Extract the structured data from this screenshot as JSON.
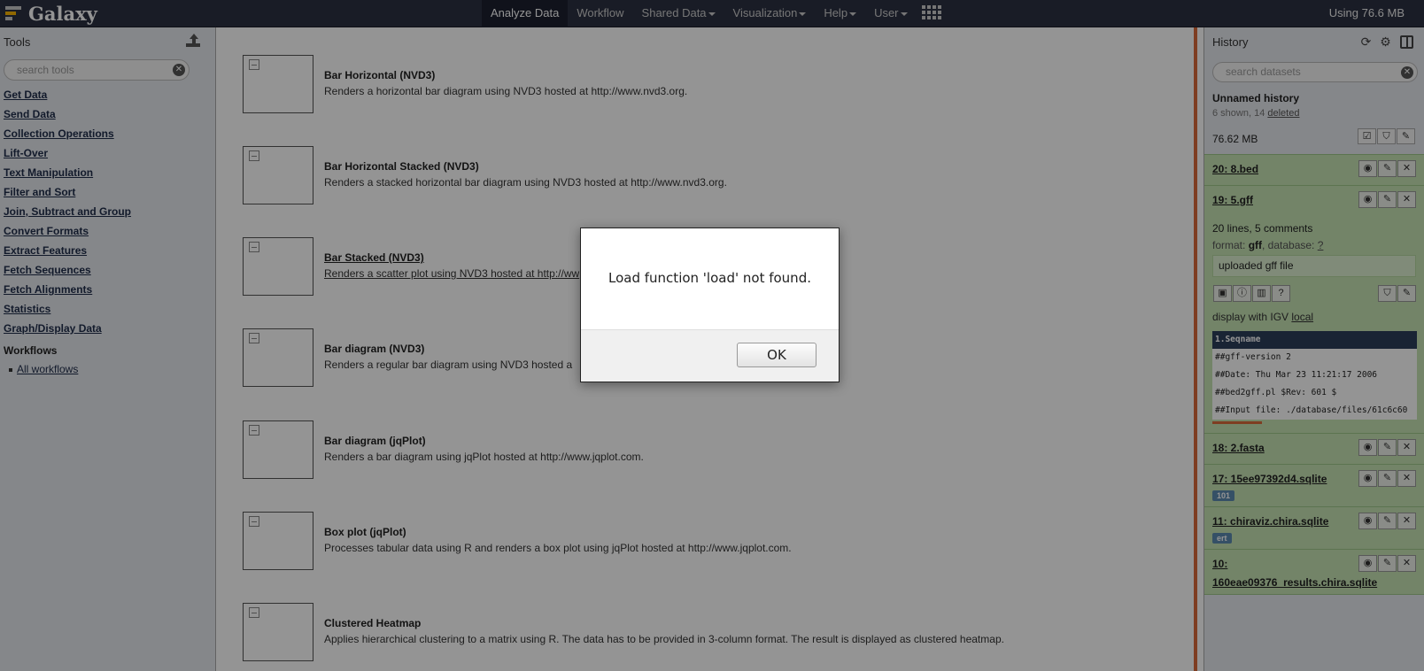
{
  "masthead": {
    "brand": "Galaxy",
    "nav": [
      {
        "label": "Analyze Data",
        "active": true,
        "dropdown": false
      },
      {
        "label": "Workflow",
        "active": false,
        "dropdown": false
      },
      {
        "label": "Shared Data",
        "active": false,
        "dropdown": true
      },
      {
        "label": "Visualization",
        "active": false,
        "dropdown": true
      },
      {
        "label": "Help",
        "active": false,
        "dropdown": true
      },
      {
        "label": "User",
        "active": false,
        "dropdown": true
      }
    ],
    "quota": "Using 76.6 MB"
  },
  "tools": {
    "title": "Tools",
    "search_placeholder": "search tools",
    "sections": [
      "Get Data",
      "Send Data",
      "Collection Operations",
      "Lift-Over",
      "Text Manipulation",
      "Filter and Sort",
      "Join, Subtract and Group",
      "Convert Formats",
      "Extract Features",
      "Fetch Sequences",
      "Fetch Alignments",
      "Statistics",
      "Graph/Display Data"
    ],
    "workflows_title": "Workflows",
    "workflows_link": "All workflows"
  },
  "visualizations": [
    {
      "name": "Bar Horizontal (NVD3)",
      "desc": "Renders a horizontal bar diagram using NVD3 hosted at http://www.nvd3.org."
    },
    {
      "name": "Bar Horizontal Stacked (NVD3)",
      "desc": "Renders a stacked horizontal bar diagram using NVD3 hosted at http://www.nvd3.org."
    },
    {
      "name": "Bar Stacked (NVD3)",
      "desc": "Renders a scatter plot using NVD3 hosted at http://ww"
    },
    {
      "name": "Bar diagram (NVD3)",
      "desc": "Renders a regular bar diagram using NVD3 hosted a"
    },
    {
      "name": "Bar diagram (jqPlot)",
      "desc": "Renders a bar diagram using jqPlot hosted at http://www.jqplot.com."
    },
    {
      "name": "Box plot (jqPlot)",
      "desc": "Processes tabular data using R and renders a box plot using jqPlot hosted at http://www.jqplot.com."
    },
    {
      "name": "Clustered Heatmap",
      "desc": "Applies hierarchical clustering to a matrix using R. The data has to be provided in 3-column format. The result is displayed as clustered heatmap."
    }
  ],
  "history": {
    "title": "History",
    "search_placeholder": "search datasets",
    "name": "Unnamed history",
    "counts_prefix": "6 shown, 14 ",
    "counts_link": "deleted",
    "size": "76.62 MB",
    "datasets": [
      {
        "title": "20: 8.bed"
      },
      {
        "title": "19: 5.gff"
      },
      {
        "title": "18: 2.fasta"
      },
      {
        "title": "17: 15ee97392d4.sqlite",
        "tag": "101"
      },
      {
        "title": "11: chiraviz.chira.sqlite",
        "tag": "ert"
      },
      {
        "title": "10:",
        "title2": "160eae09376_results.chira.sqlite"
      }
    ],
    "expanded": {
      "summary": "20 lines, 5 comments",
      "format_label": "format: ",
      "format_value": "gff",
      "database_label": ", database: ",
      "database_value": "?",
      "info": "uploaded gff file",
      "display_prefix": "display with IGV ",
      "display_link": "local",
      "peek_header": "1.Seqname",
      "peek_lines": [
        "##gff-version 2",
        "##Date: Thu Mar 23 11:21:17 2006",
        "##bed2gff.pl $Rev: 601 $",
        "##Input file: ./database/files/61c6c60"
      ]
    }
  },
  "dialog": {
    "message": "Load function 'load' not found.",
    "ok_label": "OK"
  },
  "colors": {
    "masthead": "#2c3143",
    "dataset_ok": "#c6e3b4",
    "scroll_accent": "#d96a3a"
  }
}
